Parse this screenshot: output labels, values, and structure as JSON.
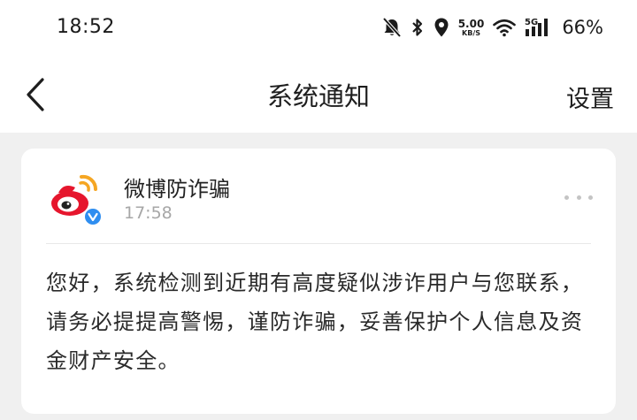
{
  "status_bar": {
    "time": "18:52",
    "net_speed_value": "5.00",
    "net_speed_unit": "KB/S",
    "network_type": "5G",
    "battery": "66%",
    "icons": [
      "bell-off-icon",
      "bluetooth-icon",
      "location-icon",
      "wifi-icon",
      "cellular-signal-icon"
    ]
  },
  "nav": {
    "title": "系统通知",
    "settings_label": "设置",
    "back_icon": "chevron-left-icon"
  },
  "notification": {
    "sender": "微博防诈骗",
    "time": "17:58",
    "verified": true,
    "avatar_icon": "weibo-logo-icon",
    "message": "您好，系统检测到近期有高度疑似涉诈用户与您联系，请务必提提高警惕，谨防诈骗，妥善保护个人信息及资金财产安全。"
  },
  "colors": {
    "background": "#f0f0f0",
    "card": "#ffffff",
    "weibo_red": "#e6162d",
    "weibo_orange": "#f5a623",
    "verified_blue": "#2f8ef0",
    "secondary_text": "#a7a7a7"
  }
}
